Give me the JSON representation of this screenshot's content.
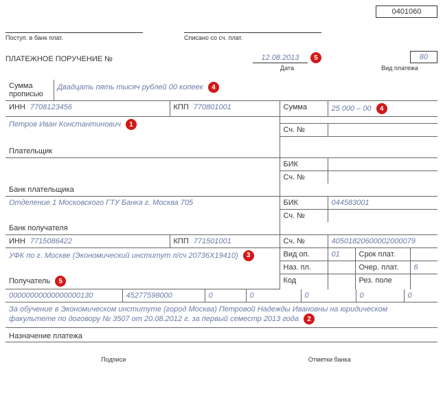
{
  "header": {
    "form_code": "0401060",
    "bank_in_label": "Поступ. в банк плат.",
    "bank_out_label": "Списано со сч. плат."
  },
  "title": {
    "doc_title": "ПЛАТЕЖНОЕ ПОРУЧЕНИЕ №",
    "date_value": "12.08.2013",
    "date_caption": "Дата",
    "paytype_caption": "Вид платежа",
    "paytype_value": "80"
  },
  "sum_words": {
    "label": "Сумма\nпрописью",
    "value": "Двадцать пять тысяч рублей 00 копеек"
  },
  "payer": {
    "inn_label": "ИНН",
    "inn_value": "7708123456",
    "kpp_label": "КПП",
    "kpp_value": "770801001",
    "sum_label": "Сумма",
    "sum_value": "25 000 – 00",
    "name_value": "Петров Иван Константинович",
    "payer_label": "Плательщик",
    "acct_label": "Сч. №",
    "bik_label": "БИК",
    "payer_bank_label": "Банк плательщика"
  },
  "recipient": {
    "bank_value": "Отделение 1 Московского ГТУ Банка г. Москва 705",
    "bank_label": "Банк получателя",
    "bik_label": "БИК",
    "bik_value": "044583001",
    "acct_label": "Сч. №",
    "acct_value": "40501820600002000079",
    "inn_label": "ИНН",
    "inn_value": "7715086422",
    "kpp_label": "КПП",
    "kpp_value": "771501001",
    "name_value": "УФК по г. Москве (Экономический институт л/сч 20736Х19410)",
    "recipient_label": "Получатель",
    "vid_op_label": "Вид оп.",
    "vid_op_value": "01",
    "srok_label": "Срок плат.",
    "naz_pl_label": "Наз. пл.",
    "ocher_label": "Очер. плат.",
    "ocher_value": "6",
    "kod_label": "Код",
    "rez_label": "Рез. поле"
  },
  "codes_row": {
    "c1": "00000000000000000130",
    "c2": "45277598000",
    "c3": "0",
    "c4": "0",
    "c5": "0",
    "c6": "0",
    "c7": "0"
  },
  "purpose": {
    "text": "За обучение в Экономическом институте (город Москва) Петровой Надежды Ивановны на юридическом факультете по договору № 3507 от 20.08.2012 г. за первый семестр 2013 года",
    "label": "Назначение платежа"
  },
  "footer": {
    "signatures": "Подписи",
    "bank_marks": "Отметки банка"
  },
  "markers": {
    "m1": "1",
    "m2": "2",
    "m3": "3",
    "m4": "4",
    "m5": "5"
  }
}
